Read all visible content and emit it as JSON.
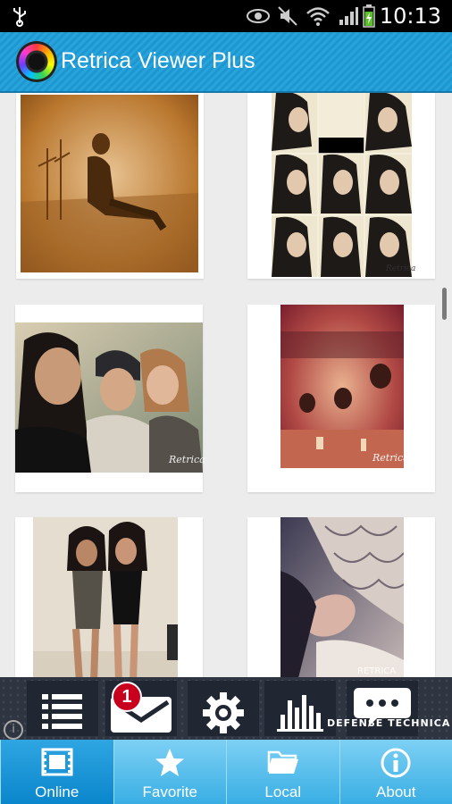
{
  "status_bar": {
    "time": "10:13"
  },
  "app": {
    "title": "Retrica Viewer Plus"
  },
  "photos": [
    {
      "watermark": ""
    },
    {
      "watermark": "Retrica"
    },
    {
      "watermark": "Retrica"
    },
    {
      "watermark": "Retrica"
    },
    {
      "watermark": ""
    },
    {
      "watermark": "RETRICA"
    }
  ],
  "ad_bar": {
    "badge_count": "1",
    "brand_text": "DEFENSE TECHNICA"
  },
  "tabs": [
    {
      "label": "Online",
      "icon": "film-icon",
      "active": true
    },
    {
      "label": "Favorite",
      "icon": "star-icon",
      "active": false
    },
    {
      "label": "Local",
      "icon": "folder-icon",
      "active": false
    },
    {
      "label": "About",
      "icon": "info-icon",
      "active": false
    }
  ]
}
